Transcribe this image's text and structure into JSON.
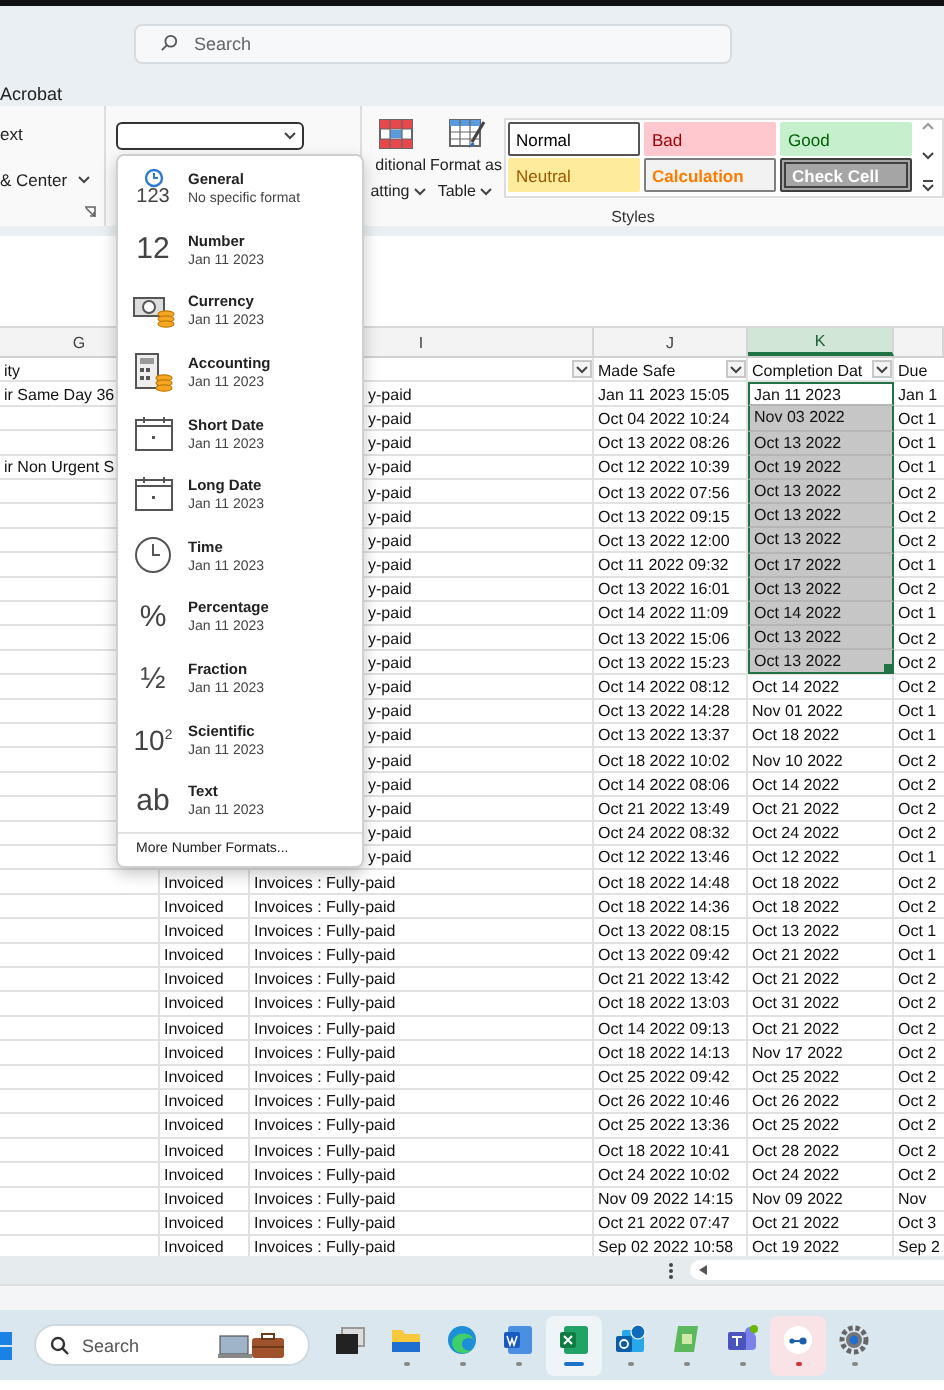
{
  "title_bar": {
    "search": {
      "placeholder": "Search"
    }
  },
  "ribbon": {
    "tab": "Acrobat",
    "alignment": {
      "wrap_label": "ext",
      "merge_label": "& Center"
    },
    "conditional_formatting": {
      "lines": [
        "ditional",
        "atting"
      ]
    },
    "format_as_table": {
      "lines": [
        "Format as",
        "Table"
      ]
    },
    "styles": [
      {
        "label": "Normal",
        "kind": "normal"
      },
      {
        "label": "Bad",
        "kind": "bad"
      },
      {
        "label": "Good",
        "kind": "good"
      },
      {
        "label": "Neutral",
        "kind": "neutral"
      },
      {
        "label": "Calculation",
        "kind": "calculation"
      },
      {
        "label": "Check Cell",
        "kind": "check"
      }
    ],
    "styles_label": "Styles"
  },
  "number_format_menu": {
    "items": [
      {
        "kind": "general",
        "glyph": "123",
        "name": "General",
        "example": "No specific format"
      },
      {
        "kind": "number",
        "glyph": "12",
        "name": "Number",
        "example": "Jan 11 2023"
      },
      {
        "kind": "currency",
        "name": "Currency",
        "example": "Jan 11 2023"
      },
      {
        "kind": "accounting",
        "name": "Accounting",
        "example": "Jan 11 2023"
      },
      {
        "kind": "short_date",
        "name": "Short Date",
        "example": "Jan 11 2023"
      },
      {
        "kind": "long_date",
        "name": "Long Date",
        "example": "Jan 11 2023"
      },
      {
        "kind": "time",
        "name": "Time",
        "example": "Jan 11 2023"
      },
      {
        "kind": "percentage",
        "glyph": "%",
        "name": "Percentage",
        "example": "Jan 11 2023"
      },
      {
        "kind": "fraction",
        "glyph": "½",
        "name": "Fraction",
        "example": "Jan 11 2023"
      },
      {
        "kind": "scientific",
        "glyph": "10$^{2}$",
        "name": "Scientific",
        "example": "Jan 11 2023"
      },
      {
        "kind": "text",
        "glyph": "ab",
        "name": "Text",
        "example": "Jan 11 2023"
      }
    ],
    "more": "More Number Formats..."
  },
  "sheet": {
    "columns": {
      "g": {
        "label": "G",
        "selected": false
      },
      "i": {
        "label": "I",
        "selected": false
      },
      "j": {
        "label": "J",
        "selected": false
      },
      "k": {
        "label": "K",
        "selected": true
      }
    },
    "header_row": {
      "g": {
        "text": "ity"
      },
      "i": {
        "filter": true
      },
      "j": {
        "text": "Made Safe",
        "filter": true
      },
      "k": {
        "text": "Completion Dat",
        "filter": true
      },
      "l": {
        "text": "Due",
        "filter": false
      }
    },
    "rows": [
      {
        "g": "ir Same Day 36",
        "i": "y-paid",
        "made_safe": "Jan 11 2023 15:05",
        "completion": "Jan 11 2023",
        "due": "Jan 1",
        "selected": true,
        "active": true
      },
      {
        "i": "y-paid",
        "made_safe": "Oct 04 2022 10:24",
        "completion": "Nov 03 2022",
        "due": "Oct 1",
        "selected": true,
        "active": false
      },
      {
        "i": "y-paid",
        "made_safe": "Oct 13 2022 08:26",
        "completion": "Oct 13 2022",
        "due": "Oct 1",
        "selected": true,
        "active": false
      },
      {
        "g": "ir Non Urgent S",
        "i": "y-paid",
        "made_safe": "Oct 12 2022 10:39",
        "completion": "Oct 19 2022",
        "due": "Oct 1",
        "selected": true,
        "active": false
      },
      {
        "i": "y-paid",
        "made_safe": "Oct 13 2022 07:56",
        "completion": "Oct 13 2022",
        "due": "Oct 2",
        "selected": true,
        "active": false
      },
      {
        "i": "y-paid",
        "made_safe": "Oct 13 2022 09:15",
        "completion": "Oct 13 2022",
        "due": "Oct 2",
        "selected": true,
        "active": false
      },
      {
        "i": "y-paid",
        "made_safe": "Oct 13 2022 12:00",
        "completion": "Oct 13 2022",
        "due": "Oct 2",
        "selected": true,
        "active": false
      },
      {
        "i": "y-paid",
        "made_safe": "Oct 11 2022 09:32",
        "completion": "Oct 17 2022",
        "due": "Oct 1",
        "selected": true,
        "active": false
      },
      {
        "i": "y-paid",
        "made_safe": "Oct 13 2022 16:01",
        "completion": "Oct 13 2022",
        "due": "Oct 2",
        "selected": true,
        "active": false
      },
      {
        "i": "y-paid",
        "made_safe": "Oct 14 2022 11:09",
        "completion": "Oct 14 2022",
        "due": "Oct 1",
        "selected": true,
        "active": false
      },
      {
        "i": "y-paid",
        "made_safe": "Oct 13 2022 15:06",
        "completion": "Oct 13 2022",
        "due": "Oct 2",
        "selected": true,
        "active": false
      },
      {
        "i": "y-paid",
        "made_safe": "Oct 13 2022 15:23",
        "completion": "Oct 13 2022",
        "due": "Oct 2",
        "selected": true,
        "active": false
      },
      {
        "i": "y-paid",
        "made_safe": "Oct 14 2022 08:12",
        "completion": "Oct 14 2022",
        "due": "Oct 2",
        "selected": false,
        "active": false
      },
      {
        "i": "y-paid",
        "made_safe": "Oct 13 2022 14:28",
        "completion": "Nov 01 2022",
        "due": "Oct 1",
        "selected": false,
        "active": false
      },
      {
        "i": "y-paid",
        "made_safe": "Oct 13 2022 13:37",
        "completion": "Oct 18 2022",
        "due": "Oct 1",
        "selected": false,
        "active": false
      },
      {
        "i": "y-paid",
        "made_safe": "Oct 18 2022 10:02",
        "completion": "Nov 10 2022",
        "due": "Oct 2",
        "selected": false,
        "active": false
      },
      {
        "i": "y-paid",
        "made_safe": "Oct 14 2022 08:06",
        "completion": "Oct 14 2022",
        "due": "Oct 2",
        "selected": false,
        "active": false
      },
      {
        "i": "y-paid",
        "made_safe": "Oct 21 2022 13:49",
        "completion": "Oct 21 2022",
        "due": "Oct 2",
        "selected": false,
        "active": false
      },
      {
        "i": "y-paid",
        "made_safe": "Oct 24 2022 08:32",
        "completion": "Oct 24 2022",
        "due": "Oct 2",
        "selected": false,
        "active": false
      },
      {
        "i": "y-paid",
        "made_safe": "Oct 12 2022 13:46",
        "completion": "Oct 12 2022",
        "due": "Oct 1",
        "selected": false,
        "active": false
      },
      {
        "h": "Invoiced",
        "i": "Invoices : Fully-paid",
        "made_safe": "Oct 18 2022 14:48",
        "completion": "Oct 18 2022",
        "due": "Oct 2",
        "selected": false,
        "active": false
      },
      {
        "h": "Invoiced",
        "i": "Invoices : Fully-paid",
        "made_safe": "Oct 18 2022 14:36",
        "completion": "Oct 18 2022",
        "due": "Oct 2",
        "selected": false,
        "active": false
      },
      {
        "h": "Invoiced",
        "i": "Invoices : Fully-paid",
        "made_safe": "Oct 13 2022 08:15",
        "completion": "Oct 13 2022",
        "due": "Oct 1",
        "selected": false,
        "active": false
      },
      {
        "h": "Invoiced",
        "i": "Invoices : Fully-paid",
        "made_safe": "Oct 13 2022 09:42",
        "completion": "Oct 21 2022",
        "due": "Oct 1",
        "selected": false,
        "active": false
      },
      {
        "h": "Invoiced",
        "i": "Invoices : Fully-paid",
        "made_safe": "Oct 21 2022 13:42",
        "completion": "Oct 21 2022",
        "due": "Oct 2",
        "selected": false,
        "active": false
      },
      {
        "h": "Invoiced",
        "i": "Invoices : Fully-paid",
        "made_safe": "Oct 18 2022 13:03",
        "completion": "Oct 31 2022",
        "due": "Oct 2",
        "selected": false,
        "active": false
      },
      {
        "h": "Invoiced",
        "i": "Invoices : Fully-paid",
        "made_safe": "Oct 14 2022 09:13",
        "completion": "Oct 21 2022",
        "due": "Oct 2",
        "selected": false,
        "active": false
      },
      {
        "h": "Invoiced",
        "i": "Invoices : Fully-paid",
        "made_safe": "Oct 18 2022 14:13",
        "completion": "Nov 17 2022",
        "due": "Oct 2",
        "selected": false,
        "active": false
      },
      {
        "h": "Invoiced",
        "i": "Invoices : Fully-paid",
        "made_safe": "Oct 25 2022 09:42",
        "completion": "Oct 25 2022",
        "due": "Oct 2",
        "selected": false,
        "active": false
      },
      {
        "h": "Invoiced",
        "i": "Invoices : Fully-paid",
        "made_safe": "Oct 26 2022 10:46",
        "completion": "Oct 26 2022",
        "due": "Oct 2",
        "selected": false,
        "active": false
      },
      {
        "h": "Invoiced",
        "i": "Invoices : Fully-paid",
        "made_safe": "Oct 25 2022 13:36",
        "completion": "Oct 25 2022",
        "due": "Oct 2",
        "selected": false,
        "active": false
      },
      {
        "h": "Invoiced",
        "i": "Invoices : Fully-paid",
        "made_safe": "Oct 18 2022 10:41",
        "completion": "Oct 28 2022",
        "due": "Oct 2",
        "selected": false,
        "active": false
      },
      {
        "h": "Invoiced",
        "i": "Invoices : Fully-paid",
        "made_safe": "Oct 24 2022 10:02",
        "completion": "Oct 24 2022",
        "due": "Oct 2",
        "selected": false,
        "active": false
      },
      {
        "h": "Invoiced",
        "i": "Invoices : Fully-paid",
        "made_safe": "Nov 09 2022 14:15",
        "completion": "Nov 09 2022",
        "due": "Nov",
        "selected": false,
        "active": false
      },
      {
        "h": "Invoiced",
        "i": "Invoices : Fully-paid",
        "made_safe": "Oct 21 2022 07:47",
        "completion": "Oct 21 2022",
        "due": "Oct 3",
        "selected": false,
        "active": false
      },
      {
        "h": "Invoiced",
        "i": "Invoices : Fully-paid",
        "made_safe": "Sep 02 2022 10:58",
        "completion": "Oct 19 2022",
        "due": "Sep 2",
        "selected": false,
        "active": false
      }
    ]
  },
  "taskbar": {
    "search": {
      "placeholder": "Search"
    },
    "apps": [
      {
        "kind": "task_view",
        "open": false,
        "selected": false,
        "alert": false
      },
      {
        "kind": "folder",
        "open": true,
        "selected": false,
        "alert": false
      },
      {
        "kind": "browser",
        "open": true,
        "selected": false,
        "alert": false
      },
      {
        "kind": "word",
        "open": true,
        "selected": false,
        "alert": false
      },
      {
        "kind": "excel",
        "open": true,
        "selected": true,
        "alert": false
      },
      {
        "kind": "mail",
        "open": true,
        "selected": false,
        "alert": false
      },
      {
        "kind": "green_app",
        "open": true,
        "selected": false,
        "alert": false
      },
      {
        "kind": "teams",
        "open": true,
        "selected": false,
        "alert": false
      },
      {
        "kind": "pink_app",
        "open": true,
        "selected": false,
        "alert": true
      },
      {
        "kind": "settings",
        "open": true,
        "selected": false,
        "alert": false
      }
    ]
  }
}
